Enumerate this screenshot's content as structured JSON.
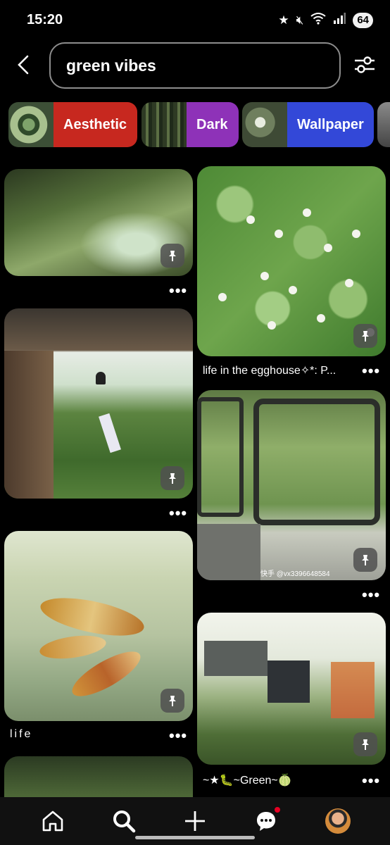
{
  "status_bar": {
    "time": "15:20",
    "battery": "64",
    "icons": [
      "star-icon",
      "mute-icon",
      "wifi-icon",
      "signal-icon"
    ]
  },
  "search": {
    "query": "green vibes"
  },
  "chips": [
    {
      "label": "Aesthetic",
      "color": "#c7281f"
    },
    {
      "label": "Dark",
      "color": "#8e32b8"
    },
    {
      "label": "Wallpaper",
      "color": "#3348d8"
    }
  ],
  "pins": {
    "left": [
      {
        "caption": "",
        "more": "•••"
      },
      {
        "caption": "",
        "more": "•••"
      },
      {
        "caption": "life",
        "more": "•••"
      },
      {
        "caption": "",
        "more": ""
      }
    ],
    "right": [
      {
        "caption": "life in the egghouse✧*: P...",
        "more": "•••"
      },
      {
        "caption": "",
        "more": "•••",
        "overlay": "快手 @vx3396648584"
      },
      {
        "caption": "~★🐛~Green~🍈",
        "more": "•••"
      }
    ]
  },
  "nav": {
    "items": [
      "home-icon",
      "search-icon",
      "create-icon",
      "messages-icon",
      "profile-avatar"
    ]
  },
  "colors": {
    "background": "#000000",
    "accent_red": "#e60023"
  }
}
